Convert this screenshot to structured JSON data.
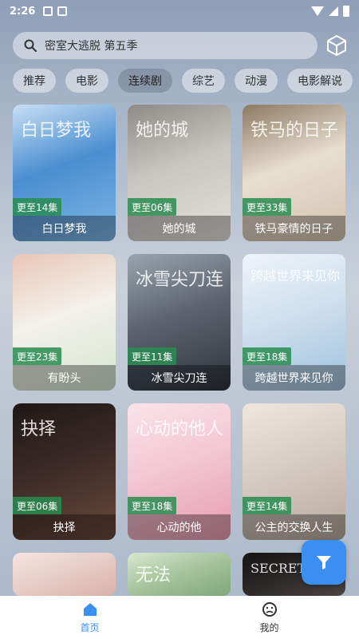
{
  "status": {
    "time": "2:26"
  },
  "search": {
    "text": "密室大逃脱 第五季"
  },
  "tabs": [
    {
      "label": "推荐",
      "active": false
    },
    {
      "label": "电影",
      "active": false
    },
    {
      "label": "连续剧",
      "active": true
    },
    {
      "label": "综艺",
      "active": false
    },
    {
      "label": "动漫",
      "active": false
    },
    {
      "label": "电影解说",
      "active": false
    }
  ],
  "cards": [
    {
      "title": "白日梦我",
      "badge": "更至14集",
      "deco": "白日梦我",
      "colors": [
        "#4a8ed1",
        "#7fb7e6",
        "#c9e0f4"
      ]
    },
    {
      "title": "她的城",
      "badge": "更至06集",
      "deco": "她的城",
      "colors": [
        "#c9c5c0",
        "#e4e1dc",
        "#8e8a86"
      ]
    },
    {
      "title": "铁马豪情的日子",
      "badge": "更至33集",
      "deco": "铁马的日子",
      "colors": [
        "#e8ded0",
        "#d2c3ae",
        "#8c7a62"
      ]
    },
    {
      "title": "有盼头",
      "badge": "更至23集",
      "deco": "",
      "colors": [
        "#f3f1ea",
        "#d8e6d0",
        "#e9c6b5"
      ]
    },
    {
      "title": "冰雪尖刀连",
      "badge": "更至11集",
      "deco": "冰雪尖刀连",
      "colors": [
        "#5b6470",
        "#2f343b",
        "#9aa4ae"
      ]
    },
    {
      "title": "跨越世界来见你",
      "badge": "更至18集",
      "deco": "跨越世界来见你",
      "colors": [
        "#cfe0ee",
        "#9fc2df",
        "#eef4fa"
      ]
    },
    {
      "title": "抉择",
      "badge": "更至06集",
      "deco": "抉择",
      "colors": [
        "#3b2a26",
        "#6b4a3c",
        "#1f1816"
      ]
    },
    {
      "title": "心动的他",
      "badge": "更至18集",
      "deco": "心动的他人",
      "colors": [
        "#f2c8d2",
        "#e89bb0",
        "#fbe3ea"
      ]
    },
    {
      "title": "公主的交换人生",
      "badge": "更至14集",
      "deco": "",
      "colors": [
        "#d7ccc4",
        "#b8a89c",
        "#efe6de"
      ]
    },
    {
      "title": "",
      "badge": "",
      "deco": "",
      "colors": [
        "#e8cfc8",
        "#d9b1a8",
        "#f5e4df"
      ]
    },
    {
      "title": "",
      "badge": "",
      "deco": "无法",
      "colors": [
        "#a9c7a0",
        "#7fa67a",
        "#d8e8cf"
      ]
    },
    {
      "title": "",
      "badge": "",
      "deco": "SECRET",
      "colors": [
        "#2a2626",
        "#4b4444",
        "#151313"
      ]
    }
  ],
  "bottom_nav": [
    {
      "label": "首页",
      "icon": "home-icon",
      "active": true
    },
    {
      "label": "我的",
      "icon": "face-icon",
      "active": false
    }
  ],
  "accent_color": "#3a8ff0"
}
